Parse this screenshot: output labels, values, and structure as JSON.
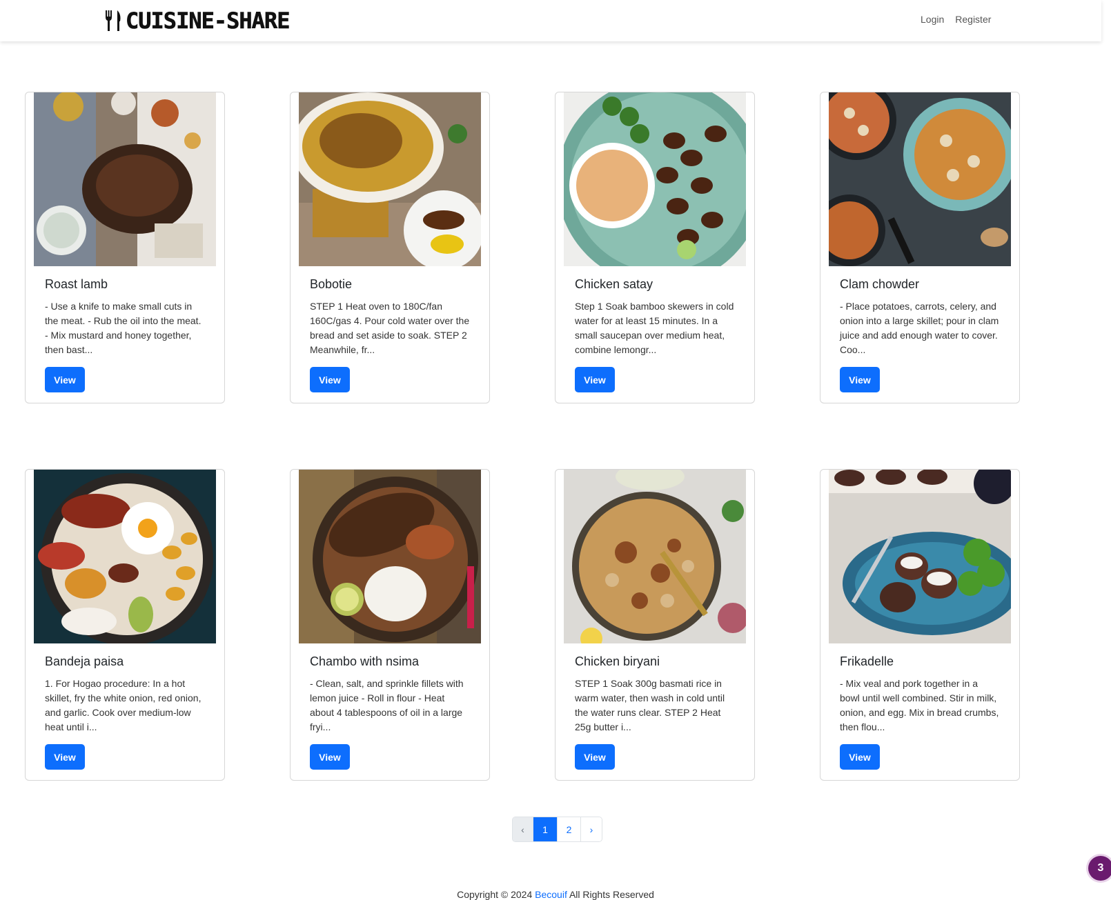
{
  "brand": {
    "name": "CUISINE-SHARE",
    "icon": "fork-knife-icon"
  },
  "nav": {
    "login": "Login",
    "register": "Register"
  },
  "recipes": [
    {
      "title": "Roast lamb",
      "excerpt": "- Use a knife to make small cuts in the meat. - Rub the oil into the meat. - Mix mustard and honey together, then bast...",
      "button": "View"
    },
    {
      "title": "Bobotie",
      "excerpt": "STEP 1 Heat oven to 180C/fan 160C/gas 4. Pour cold water over the bread and set aside to soak. STEP 2 Meanwhile, fr...",
      "button": "View"
    },
    {
      "title": "Chicken satay",
      "excerpt": "Step 1 Soak bamboo skewers in cold water for at least 15 minutes. In a small saucepan over medium heat, combine lemongr...",
      "button": "View"
    },
    {
      "title": "Clam chowder",
      "excerpt": "- Place potatoes, carrots, celery, and onion into a large skillet; pour in clam juice and add enough water to cover. Coo...",
      "button": "View"
    },
    {
      "title": "Bandeja paisa",
      "excerpt": "1. For Hogao procedure: In a hot skillet, fry the white onion, red onion, and garlic. Cook over medium-low heat until i...",
      "button": "View"
    },
    {
      "title": "Chambo with nsima",
      "excerpt": "- Clean, salt, and sprinkle fillets with lemon juice - Roll in flour - Heat about 4 tablespoons of oil in a large fryi...",
      "button": "View"
    },
    {
      "title": "Chicken biryani",
      "excerpt": "STEP 1 Soak 300g basmati rice in warm water, then wash in cold until the water runs clear. STEP 2 Heat 25g butter i...",
      "button": "View"
    },
    {
      "title": "Frikadelle",
      "excerpt": "- Mix veal and pork together in a bowl until well combined. Stir in milk, onion, and egg. Mix in bread crumbs, then flou...",
      "button": "View"
    }
  ],
  "pagination": {
    "prev": "‹",
    "pages": [
      "1",
      "2"
    ],
    "current": "1",
    "next": "›"
  },
  "footer": {
    "prefix": "Copyright © 2024",
    "link": "Becouif",
    "suffix": "All Rights Reserved"
  },
  "badge": {
    "count": "3"
  },
  "colors": {
    "primary": "#0d6efd",
    "badge": "#6a1b6e"
  }
}
